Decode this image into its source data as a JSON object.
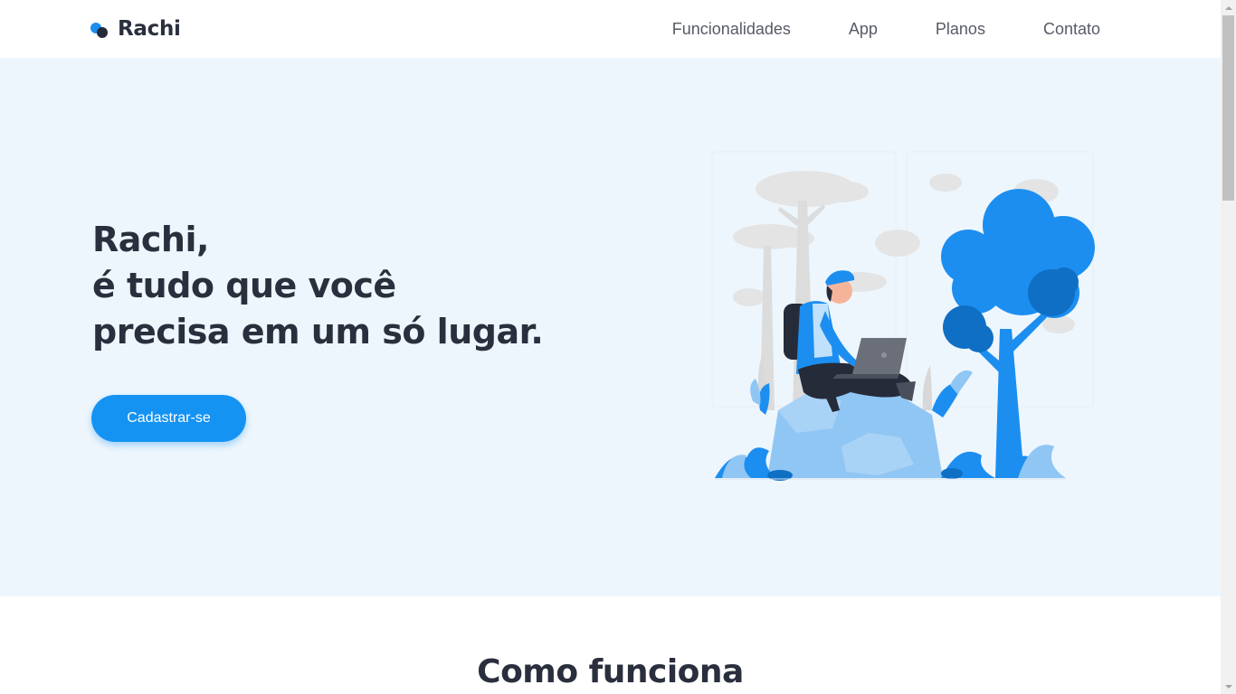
{
  "header": {
    "brand": "Rachi",
    "nav": [
      "Funcionalidades",
      "App",
      "Planos",
      "Contato"
    ]
  },
  "hero": {
    "title_lines": [
      "Rachi,",
      "é tudo que você",
      "precisa em um só lugar."
    ],
    "cta_label": "Cadastrar-se"
  },
  "section": {
    "title": "Como funciona"
  },
  "colors": {
    "accent": "#1593f3",
    "text_dark": "#2a2f3d",
    "hero_bg": "#eef6fd"
  },
  "icons": {
    "logo": "two-dots-logo-icon",
    "illustration": "person-with-laptop-in-nature-illustration"
  }
}
